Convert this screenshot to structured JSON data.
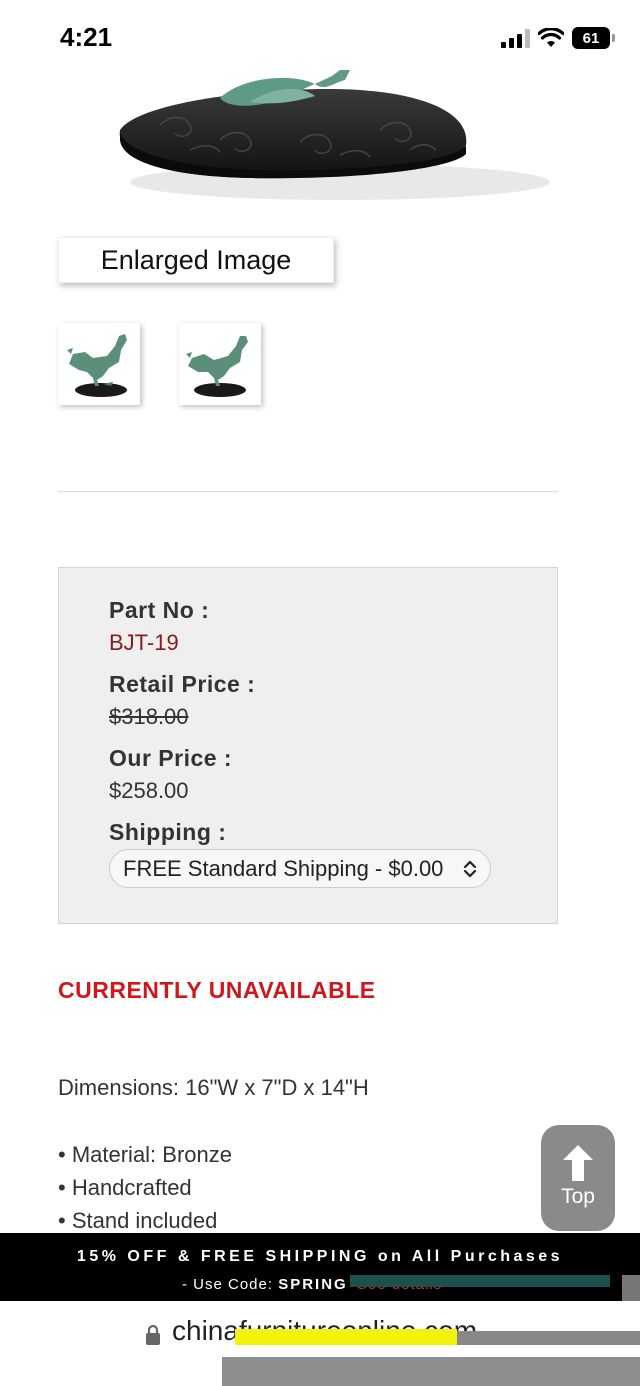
{
  "status_bar": {
    "time": "4:21",
    "battery": "61",
    "icons": [
      "signal-icon",
      "wifi-icon",
      "battery-icon"
    ]
  },
  "gallery": {
    "enlarge_label": "Enlarged Image",
    "thumbnails": [
      "thumbnail-1",
      "thumbnail-2"
    ]
  },
  "product": {
    "part_no_label": "Part No :",
    "part_no": "BJT-19",
    "retail_label": "Retail Price :",
    "retail_price": "$318.00",
    "our_label": "Our Price :",
    "our_price": "$258.00",
    "shipping_label": "Shipping :",
    "shipping_selected": "FREE Standard Shipping - $0.00",
    "availability": "CURRENTLY UNAVAILABLE",
    "dimensions": "Dimensions: 16\"W x 7\"D x 14\"H",
    "features": [
      "• Material: Bronze",
      "• Handcrafted",
      "• Stand included"
    ]
  },
  "top_button": {
    "label": "Top"
  },
  "promo": {
    "line1": "15% OFF & FREE SHIPPING on All Purchases",
    "code_prefix": "- Use Code:",
    "code": "SPRING",
    "details": "See details*"
  },
  "browser": {
    "url": "chinafurnitureonline.com"
  },
  "colors": {
    "part_no": "#8b1a1a",
    "availability": "#d0181b",
    "promo_bg": "#000000",
    "top_button_bg": "#8a8a8a"
  }
}
